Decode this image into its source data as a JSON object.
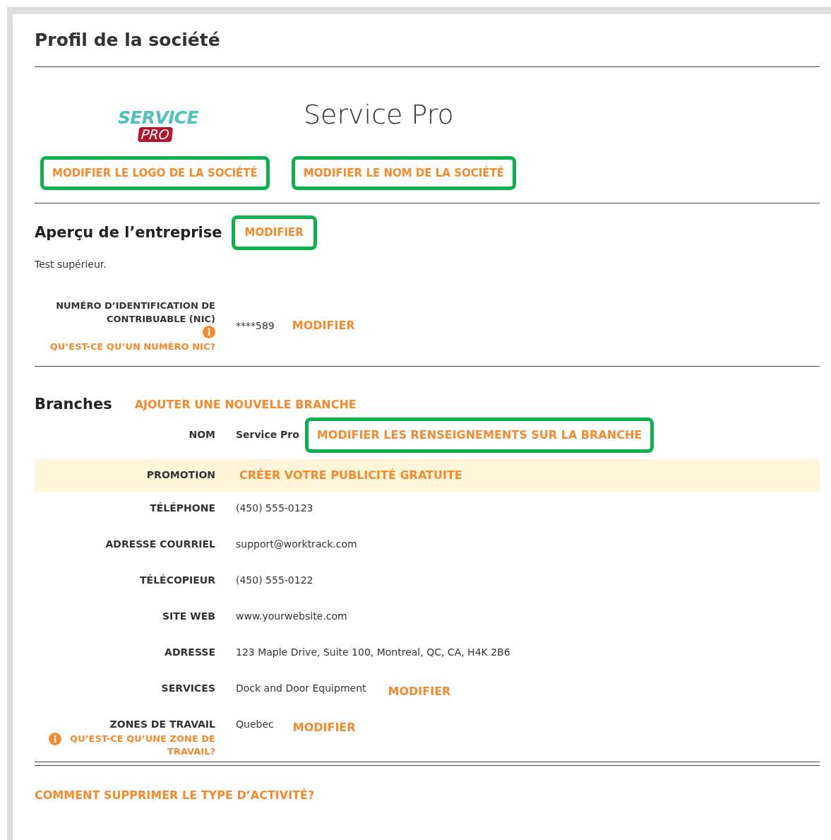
{
  "title": "Profil de la société",
  "logo": {
    "top": "SERVICE",
    "bottom": "PRO"
  },
  "company_name": "Service Pro",
  "company_links": [
    {
      "label": "MODIFIER LE LOGO DE LA SOCIÉTÉ",
      "highlighted": true
    },
    {
      "label": "MODIFIER LE NOM DE LA SOCIÉTÉ",
      "highlighted": true
    }
  ],
  "overview": {
    "heading": "Aperçu de l’entreprise",
    "link": {
      "label": "MODIFIER",
      "highlighted": true
    },
    "text": "Test supérieur."
  },
  "nic": {
    "label": "NUMÉRO D’IDENTIFICATION DE CONTRIBUABLE (NIC)",
    "help": "QU’EST-CE QU’UN NUMÉRO NIC?",
    "value": "****589",
    "link": "MODIFIER"
  },
  "branches": {
    "heading": "Branches",
    "add_link": "AJOUTER UNE NOUVELLE BRANCHE",
    "rows": [
      {
        "kind": "field",
        "label": "NOM",
        "value": "Service Pro",
        "link": {
          "label": "MODIFIER LES RENSEIGNEMENTS SUR LA BRANCHE",
          "highlighted": true
        }
      },
      {
        "kind": "promo",
        "label": "PROMOTION",
        "link": {
          "label": "CRÉER VOTRE PUBLICITÉ GRATUITE",
          "highlighted": false
        }
      },
      {
        "kind": "field",
        "label": "TÉLÉPHONE",
        "value": "(450) 555-0123"
      },
      {
        "kind": "field",
        "label": "ADRESSE COURRIEL",
        "value": "support@worktrack.com"
      },
      {
        "kind": "field",
        "label": "TÉLÉCOPIEUR",
        "value": "(450) 555-0122"
      },
      {
        "kind": "field",
        "label": "SITE WEB",
        "value": "www.yourwebsite.com"
      },
      {
        "kind": "field",
        "label": "ADRESSE",
        "value": "123 Maple Drive, Suite 100, Montreal, QC, CA, H4K 2B6"
      },
      {
        "kind": "field",
        "label": "SERVICES",
        "value": "Dock and Door Equipment",
        "link": {
          "label": "MODIFIER",
          "highlighted": false
        }
      },
      {
        "kind": "help",
        "label": "ZONES DE TRAVAIL",
        "help": "QU’EST-CE QU’UNE ZONE DE TRAVAIL?",
        "value": "Quebec",
        "link": {
          "label": "MODIFIER",
          "highlighted": false
        }
      }
    ]
  },
  "footer_link": "COMMENT SUPPRIMER LE TYPE D’ACTIVITÉ?"
}
